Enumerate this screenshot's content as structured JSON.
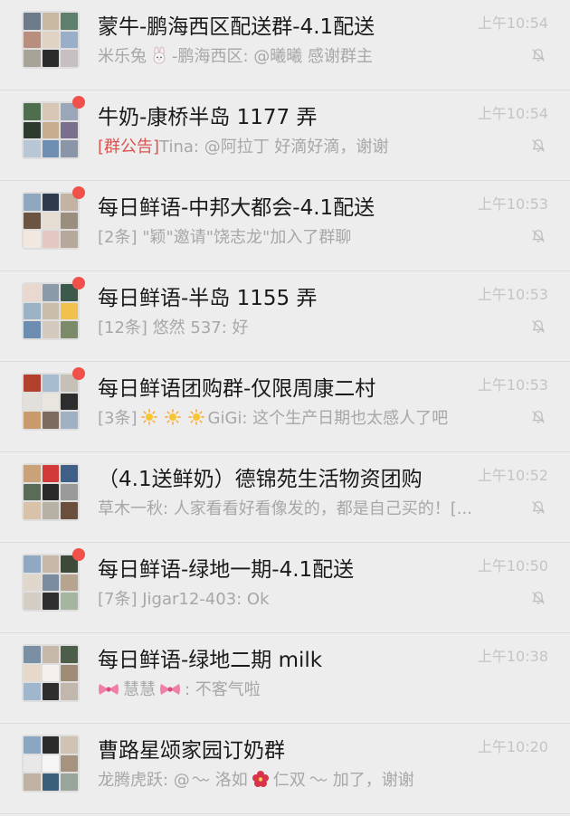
{
  "chats": [
    {
      "title": "蒙牛-鹏海西区配送群-4.1配送",
      "time": "上午10:54",
      "unread": false,
      "preview_notice": "",
      "preview_a": "米乐兔",
      "preview_b": "-鹏海西区: @曦曦 感谢群主",
      "preview_c": "",
      "preview_d": "",
      "icons": [
        "rabbit-emoji-icon"
      ],
      "muted": true,
      "avatar_colors": [
        "#6c7a8a",
        "#c9b9a2",
        "#5d7f6c",
        "#b88f7e",
        "#e0d3c4",
        "#98aec9",
        "#a8a398",
        "#2b2b2b",
        "#c7bfc2"
      ]
    },
    {
      "title": "牛奶-康桥半岛 1177 弄",
      "time": "上午10:54",
      "unread": true,
      "preview_notice": "[群公告]",
      "preview_a": "Tina: @阿拉丁 好滴好滴，谢谢",
      "preview_b": "",
      "preview_c": "",
      "preview_d": "",
      "icons": [],
      "muted": true,
      "avatar_colors": [
        "#4e6e4e",
        "#d8c7b6",
        "#9aa7b8",
        "#2f3a2f",
        "#c8ad8f",
        "#7b6f8f",
        "#b9c6d6",
        "#6f8fb2",
        "#8a96a8"
      ]
    },
    {
      "title": "每日鲜语-中邦大都会-4.1配送",
      "time": "上午10:53",
      "unread": true,
      "preview_notice": "",
      "preview_a": "[2条] \"颖\"邀请\"饶志龙\"加入了群聊",
      "preview_b": "",
      "preview_c": "",
      "preview_d": "",
      "icons": [],
      "muted": true,
      "avatar_colors": [
        "#8fa7bf",
        "#2d3b4d",
        "#c3b3a2",
        "#6b5442",
        "#e6ddd3",
        "#9a8f7e",
        "#f1e9e1",
        "#e3c7c0",
        "#b6a89a"
      ]
    },
    {
      "title": "每日鲜语-半岛 1155 弄",
      "time": "上午10:53",
      "unread": true,
      "preview_notice": "",
      "preview_a": "[12条] 悠然 537: 好",
      "preview_b": "",
      "preview_c": "",
      "preview_d": "",
      "icons": [],
      "muted": true,
      "avatar_colors": [
        "#e8d8cf",
        "#8a9aa8",
        "#3c5a4b",
        "#9cb3c5",
        "#c9bda9",
        "#f0c24b",
        "#6d8db0",
        "#d4c9bd",
        "#7b8b6a"
      ]
    },
    {
      "title": "每日鲜语团购群-仅限周康二村",
      "time": "上午10:53",
      "unread": true,
      "preview_notice": "",
      "preview_a": "[3条]",
      "preview_b": "",
      "preview_c": "GiGi: 这个生产日期也太感人了吧",
      "preview_d": "",
      "icons": [
        "sun-emoji-icon",
        "sun-emoji-icon",
        "sun-emoji-icon"
      ],
      "muted": true,
      "avatar_colors": [
        "#b1402f",
        "#a8bcd0",
        "#c7c0b7",
        "#e3e0db",
        "#e9e5df",
        "#2d2d2d",
        "#c99a6b",
        "#7c6a5e",
        "#9fb1c2"
      ]
    },
    {
      "title": "（4.1送鲜奶）德锦苑生活物资团购",
      "time": "上午10:52",
      "unread": false,
      "preview_notice": "",
      "preview_a": "草木一秋: 人家看看好看像发的，都是自己买的！[...",
      "preview_b": "",
      "preview_c": "",
      "preview_d": "",
      "icons": [],
      "muted": true,
      "avatar_colors": [
        "#c9a27a",
        "#d23a3a",
        "#3f5f86",
        "#5a6b58",
        "#2a2a2a",
        "#9a9a9a",
        "#d8c2aa",
        "#b7b0a4",
        "#6a4f3c"
      ]
    },
    {
      "title": "每日鲜语-绿地一期-4.1配送",
      "time": "上午10:50",
      "unread": true,
      "preview_notice": "",
      "preview_a": "[7条] Jigar12-403: Ok",
      "preview_b": "",
      "preview_c": "",
      "preview_d": "",
      "icons": [],
      "muted": true,
      "avatar_colors": [
        "#90a8c2",
        "#c7b8a7",
        "#3d4a3a",
        "#e0d7cc",
        "#7b8c9e",
        "#b6a48f",
        "#d3cdc6",
        "#2f2f2f",
        "#a6b5a0"
      ]
    },
    {
      "title": "每日鲜语-绿地二期 milk",
      "time": "上午10:38",
      "unread": false,
      "preview_notice": "",
      "preview_a": "",
      "preview_b": "慧慧",
      "preview_c": ": 不客气啦",
      "preview_d": "",
      "icons": [
        "bow-emoji-icon",
        "bow-emoji-icon"
      ],
      "muted": false,
      "avatar_colors": [
        "#7a8fa4",
        "#c7b9aa",
        "#4c5d4a",
        "#e6d9c9",
        "#f4f1ec",
        "#a08b76",
        "#9fb6cc",
        "#2e2e2e",
        "#c1b7ad"
      ]
    },
    {
      "title": "曹路星颂家园订奶群",
      "time": "上午10:20",
      "unread": false,
      "preview_notice": "",
      "preview_a": "龙腾虎跃: @",
      "preview_b": "洛如",
      "preview_c": "仁双",
      "preview_d": "加了，谢谢",
      "icons": [
        "swirl-emoji-icon",
        "flower-emoji-icon",
        "swirl-emoji-icon"
      ],
      "muted": false,
      "avatar_colors": [
        "#8aa6c0",
        "#2b2b2b",
        "#d1c3b4",
        "#e8e8e8",
        "#f5f5f5",
        "#a5937f",
        "#c0b2a3",
        "#3a5f7a",
        "#9aa59a"
      ]
    }
  ]
}
